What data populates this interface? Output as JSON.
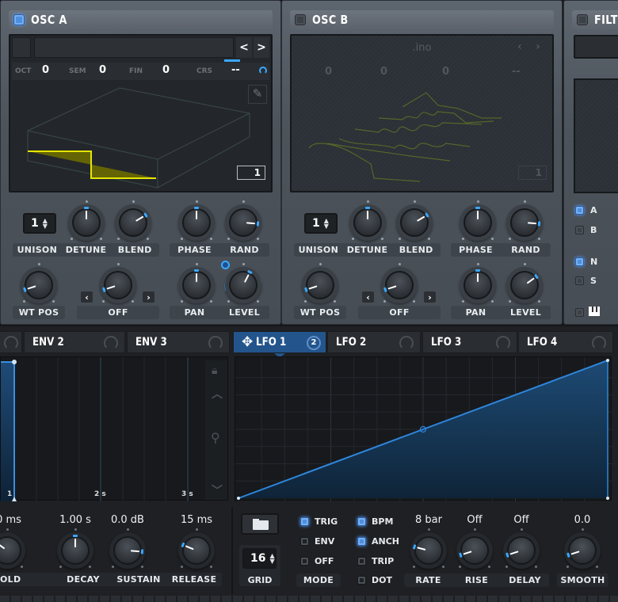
{
  "osc_a": {
    "title": "OSC A",
    "enabled": true,
    "wavetable_name": "",
    "prev_label": "<",
    "next_label": ">",
    "pitch": [
      {
        "label": "OCT",
        "value": "0"
      },
      {
        "label": "SEM",
        "value": "0"
      },
      {
        "label": "FIN",
        "value": "0"
      },
      {
        "label": "CRS",
        "value": "--"
      }
    ],
    "frame_number": "1",
    "unison_value": "1",
    "labels_row1a": [
      "UNISON",
      "DETUNE",
      "BLEND"
    ],
    "labels_row1b": [
      "PHASE",
      "RAND"
    ],
    "labels_row2a": [
      "WT POS"
    ],
    "labels_row2b": [
      "OFF"
    ],
    "labels_row2c": [
      "PAN",
      "LEVEL"
    ],
    "knob_values": {
      "detune": 0.5,
      "blend": 0.72,
      "phase": 0.5,
      "rand": 0.85,
      "wt_pos": 0.1,
      "warp": 0.1,
      "pan": 0.5,
      "level": 0.6
    }
  },
  "osc_b": {
    "title": "OSC B",
    "enabled": false,
    "wavetable_name": ".ino",
    "pitch_values": [
      "0",
      "0",
      "0",
      "--"
    ],
    "frame_number": "1",
    "unison_value": "1",
    "labels_row1a": [
      "UNISON",
      "DETUNE",
      "BLEND"
    ],
    "labels_row1b": [
      "PHASE",
      "RAND"
    ],
    "labels_row2a": [
      "WT POS"
    ],
    "labels_row2b": [
      "OFF"
    ],
    "labels_row2c": [
      "PAN",
      "LEVEL"
    ]
  },
  "filter": {
    "title": "FILTE",
    "enabled": false,
    "routing": [
      {
        "label": "A",
        "on": true
      },
      {
        "label": "B",
        "on": false
      },
      {
        "label": "N",
        "on": true
      },
      {
        "label": "S",
        "on": false
      }
    ],
    "keyboard_icon": "piano-icon"
  },
  "mod_tabs": [
    {
      "label": "",
      "active": false
    },
    {
      "label": "ENV 2",
      "active": false
    },
    {
      "label": "ENV 3",
      "active": false
    },
    {
      "label": "LFO 1",
      "active": true,
      "badge": "2"
    },
    {
      "label": "LFO 2",
      "active": false
    },
    {
      "label": "LFO 3",
      "active": false
    },
    {
      "label": "LFO 4",
      "active": false
    }
  ],
  "env": {
    "time_markers": [
      "1",
      "2 s",
      "3 s"
    ],
    "values": [
      "0 ms",
      "1.00 s",
      "0.0 dB",
      "15 ms"
    ],
    "labels": [
      "OLD",
      "DECAY",
      "SUSTAIN",
      "RELEASE"
    ]
  },
  "lfo": {
    "grid_value": "16",
    "grid_label": "GRID",
    "mode_label": "MODE",
    "mode_options": [
      {
        "label": "TRIG",
        "on": true
      },
      {
        "label": "ENV",
        "on": false
      },
      {
        "label": "OFF",
        "on": false
      }
    ],
    "timing_options": [
      {
        "label": "BPM",
        "on": true
      },
      {
        "label": "ANCH",
        "on": true
      },
      {
        "label": "TRIP",
        "on": false
      },
      {
        "label": "DOT",
        "on": false
      }
    ],
    "knob_values": [
      "8 bar",
      "Off",
      "Off",
      "0.0"
    ],
    "knob_labels": [
      "RATE",
      "RISE",
      "DELAY",
      "SMOOTH"
    ],
    "shape_points": [
      [
        0,
        0
      ],
      [
        0.5,
        0.5
      ],
      [
        1,
        1
      ]
    ]
  },
  "colors": {
    "accent": "#3aa7ff",
    "waveform": "#e6e600",
    "tab_active": "#23558c"
  }
}
